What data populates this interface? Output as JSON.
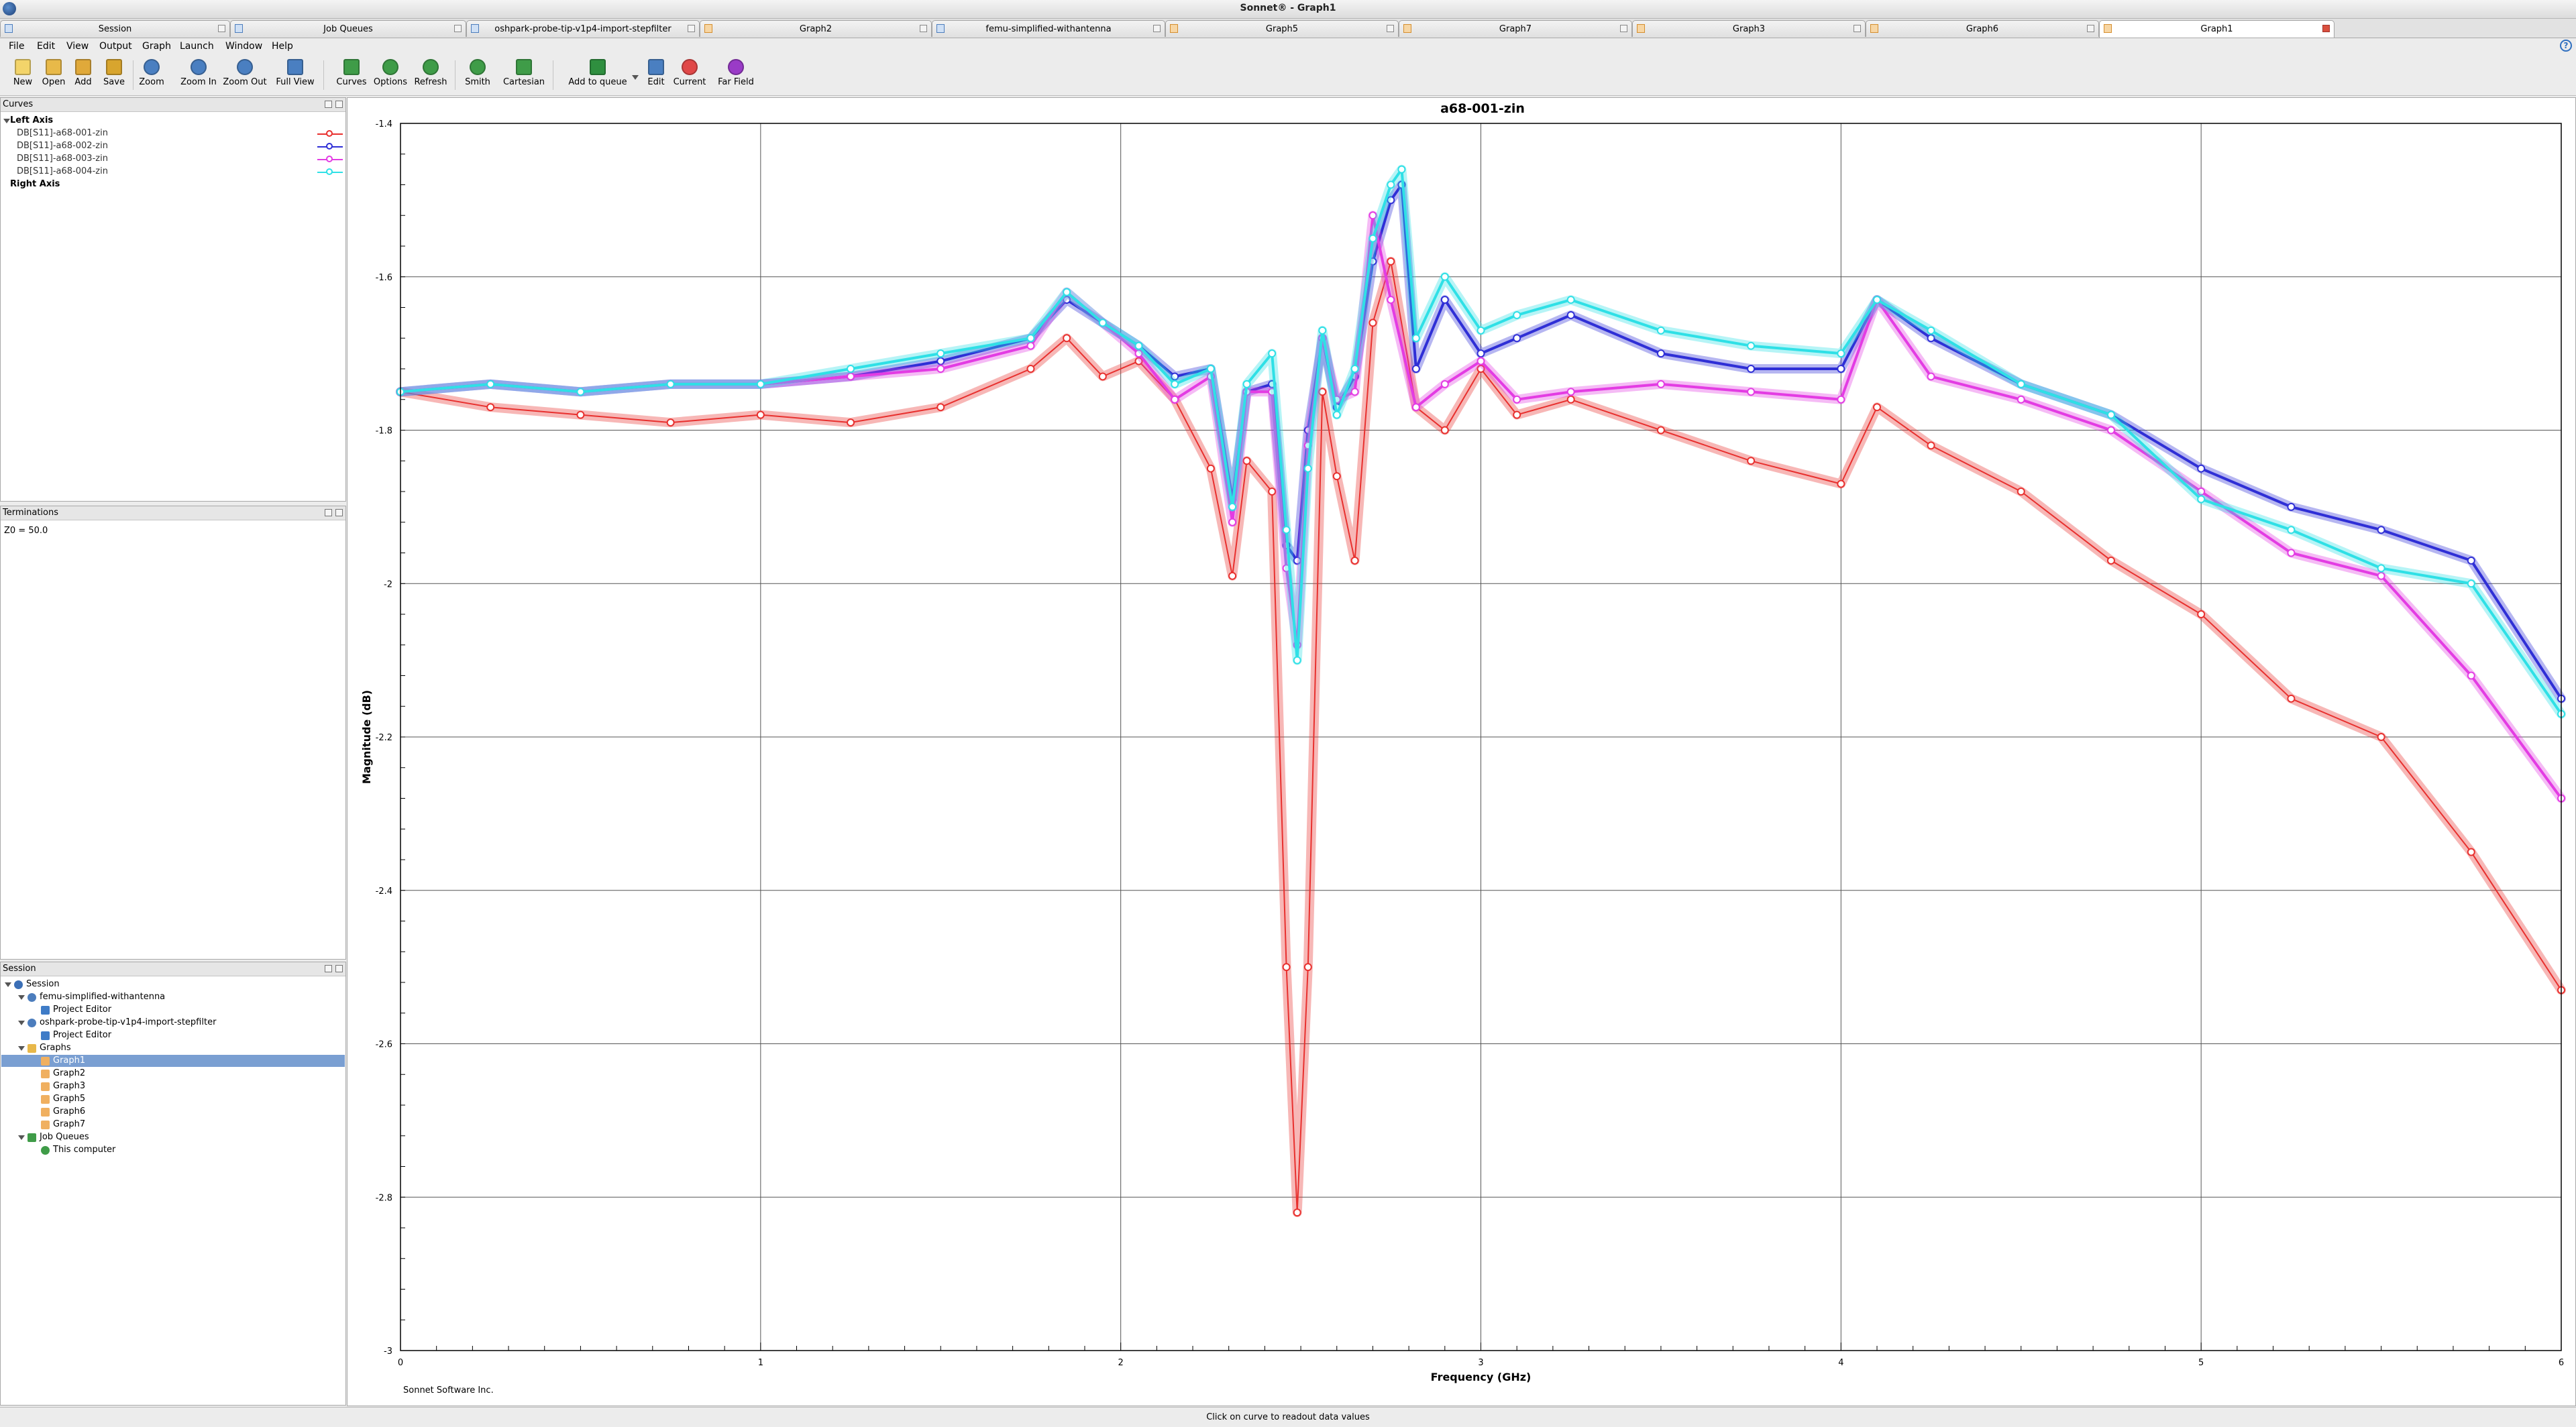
{
  "window": {
    "title": "Sonnet® - Graph1"
  },
  "tabs": [
    {
      "label": "Session",
      "icon": "session-icon"
    },
    {
      "label": "Job Queues",
      "icon": "job-queue-icon"
    },
    {
      "label": "oshpark-probe-tip-v1p4-import-stepfilter",
      "icon": "project-icon"
    },
    {
      "label": "Graph2",
      "icon": "graph-icon"
    },
    {
      "label": "femu-simplified-withantenna",
      "icon": "project-icon"
    },
    {
      "label": "Graph5",
      "icon": "graph-icon"
    },
    {
      "label": "Graph7",
      "icon": "graph-icon"
    },
    {
      "label": "Graph3",
      "icon": "graph-icon"
    },
    {
      "label": "Graph6",
      "icon": "graph-icon"
    },
    {
      "label": "Graph1",
      "icon": "graph-icon",
      "active": true
    }
  ],
  "menu": [
    "File",
    "Edit",
    "View",
    "Output",
    "Graph",
    "Launch",
    "Window",
    "Help"
  ],
  "help_icon": "?",
  "toolbar": [
    "New",
    "Open",
    "Add",
    "Save",
    "Zoom",
    "Zoom In",
    "Zoom Out",
    "Full View",
    "Curves",
    "Options",
    "Refresh",
    "Smith",
    "Cartesian",
    "Add to queue",
    "Edit",
    "Current",
    "Far Field"
  ],
  "curves_panel": {
    "title": "Curves",
    "left_axis": "Left Axis",
    "right_axis": "Right Axis",
    "items": [
      {
        "label": "DB[S11]-a68-001-zin",
        "color": "#e8302e"
      },
      {
        "label": "DB[S11]-a68-002-zin",
        "color": "#2f2fd6"
      },
      {
        "label": "DB[S11]-a68-003-zin",
        "color": "#e33ce3"
      },
      {
        "label": "DB[S11]-a68-004-zin",
        "color": "#2fe0e6"
      }
    ]
  },
  "terminations_panel": {
    "title": "Terminations",
    "text": "Z0 = 50.0"
  },
  "session_panel": {
    "title": "Session",
    "tree": [
      {
        "label": "Session",
        "level": 0,
        "expanded": true,
        "icon": "session-icon"
      },
      {
        "label": "femu-simplified-withantenna",
        "level": 1,
        "expanded": true,
        "icon": "project-icon"
      },
      {
        "label": "Project Editor",
        "level": 2,
        "icon": "editor-icon"
      },
      {
        "label": "oshpark-probe-tip-v1p4-import-stepfilter",
        "level": 1,
        "expanded": true,
        "icon": "project-icon"
      },
      {
        "label": "Project Editor",
        "level": 2,
        "icon": "editor-icon"
      },
      {
        "label": "Graphs",
        "level": 1,
        "expanded": true,
        "icon": "folder-icon"
      },
      {
        "label": "Graph1",
        "level": 2,
        "icon": "graph-icon",
        "selected": true
      },
      {
        "label": "Graph2",
        "level": 2,
        "icon": "graph-icon"
      },
      {
        "label": "Graph3",
        "level": 2,
        "icon": "graph-icon"
      },
      {
        "label": "Graph5",
        "level": 2,
        "icon": "graph-icon"
      },
      {
        "label": "Graph6",
        "level": 2,
        "icon": "graph-icon"
      },
      {
        "label": "Graph7",
        "level": 2,
        "icon": "graph-icon"
      },
      {
        "label": "Job Queues",
        "level": 1,
        "expanded": true,
        "icon": "job-queue-icon"
      },
      {
        "label": "This computer",
        "level": 2,
        "icon": "check-icon"
      }
    ]
  },
  "footer": {
    "credit": "Sonnet Software Inc.",
    "status": "Click on curve to readout data values"
  },
  "chart_data": {
    "type": "line",
    "title": "a68-001-zin",
    "xlabel": "Frequency (GHz)",
    "ylabel": "Magnitude (dB)",
    "xlim": [
      0,
      6
    ],
    "ylim": [
      -3,
      -1.4
    ],
    "xticks": [
      0,
      1,
      2,
      3,
      4,
      5,
      6
    ],
    "yticks": [
      -1.4,
      -1.6,
      -1.8,
      -2,
      -2.2,
      -2.4,
      -2.6,
      -2.8,
      -3
    ],
    "grid": true,
    "series": [
      {
        "name": "DB[S11]-a68-001-zin",
        "color": "#e8302e",
        "x": [
          0,
          0.25,
          0.5,
          0.75,
          1.0,
          1.25,
          1.5,
          1.75,
          1.85,
          1.95,
          2.05,
          2.15,
          2.25,
          2.31,
          2.35,
          2.42,
          2.46,
          2.49,
          2.52,
          2.56,
          2.6,
          2.65,
          2.7,
          2.75,
          2.82,
          2.9,
          3.0,
          3.1,
          3.25,
          3.5,
          3.75,
          4.0,
          4.1,
          4.25,
          4.5,
          4.75,
          5.0,
          5.25,
          5.5,
          5.75,
          6.0
        ],
        "y": [
          -1.75,
          -1.77,
          -1.78,
          -1.79,
          -1.78,
          -1.79,
          -1.77,
          -1.72,
          -1.68,
          -1.73,
          -1.71,
          -1.76,
          -1.85,
          -1.99,
          -1.84,
          -1.88,
          -2.5,
          -2.82,
          -2.5,
          -1.75,
          -1.86,
          -1.97,
          -1.66,
          -1.58,
          -1.77,
          -1.8,
          -1.72,
          -1.78,
          -1.76,
          -1.8,
          -1.84,
          -1.87,
          -1.77,
          -1.82,
          -1.88,
          -1.97,
          -2.04,
          -2.15,
          -2.2,
          -2.35,
          -2.53
        ]
      },
      {
        "name": "DB[S11]-a68-002-zin",
        "color": "#2f2fd6",
        "x": [
          0,
          0.25,
          0.5,
          0.75,
          1.0,
          1.25,
          1.5,
          1.75,
          1.85,
          1.95,
          2.05,
          2.15,
          2.25,
          2.31,
          2.35,
          2.42,
          2.46,
          2.49,
          2.52,
          2.56,
          2.6,
          2.65,
          2.7,
          2.75,
          2.78,
          2.82,
          2.9,
          3.0,
          3.1,
          3.25,
          3.5,
          3.75,
          4.0,
          4.1,
          4.25,
          4.5,
          4.75,
          5.0,
          5.25,
          5.5,
          5.75,
          6.0
        ],
        "y": [
          -1.75,
          -1.74,
          -1.75,
          -1.74,
          -1.74,
          -1.73,
          -1.71,
          -1.68,
          -1.63,
          -1.66,
          -1.69,
          -1.73,
          -1.72,
          -1.89,
          -1.75,
          -1.74,
          -1.95,
          -1.97,
          -1.8,
          -1.68,
          -1.77,
          -1.73,
          -1.58,
          -1.5,
          -1.48,
          -1.72,
          -1.63,
          -1.7,
          -1.68,
          -1.65,
          -1.7,
          -1.72,
          -1.72,
          -1.63,
          -1.68,
          -1.74,
          -1.78,
          -1.85,
          -1.9,
          -1.93,
          -1.97,
          -2.15
        ]
      },
      {
        "name": "DB[S11]-a68-003-zin",
        "color": "#e33ce3",
        "x": [
          0,
          0.25,
          0.5,
          0.75,
          1.0,
          1.25,
          1.5,
          1.75,
          1.85,
          1.95,
          2.05,
          2.15,
          2.25,
          2.31,
          2.35,
          2.42,
          2.46,
          2.49,
          2.52,
          2.56,
          2.6,
          2.65,
          2.7,
          2.75,
          2.82,
          2.9,
          3.0,
          3.1,
          3.25,
          3.5,
          3.75,
          4.0,
          4.1,
          4.25,
          4.5,
          4.75,
          5.0,
          5.25,
          5.5,
          5.75,
          6.0
        ],
        "y": [
          -1.75,
          -1.74,
          -1.75,
          -1.74,
          -1.74,
          -1.73,
          -1.72,
          -1.69,
          -1.62,
          -1.66,
          -1.7,
          -1.76,
          -1.73,
          -1.92,
          -1.75,
          -1.75,
          -1.98,
          -2.08,
          -1.82,
          -1.68,
          -1.76,
          -1.75,
          -1.52,
          -1.63,
          -1.77,
          -1.74,
          -1.71,
          -1.76,
          -1.75,
          -1.74,
          -1.75,
          -1.76,
          -1.63,
          -1.73,
          -1.76,
          -1.8,
          -1.88,
          -1.96,
          -1.99,
          -2.12,
          -2.28
        ]
      },
      {
        "name": "DB[S11]-a68-004-zin",
        "color": "#2fe0e6",
        "x": [
          0,
          0.25,
          0.5,
          0.75,
          1.0,
          1.25,
          1.5,
          1.75,
          1.85,
          1.95,
          2.05,
          2.15,
          2.25,
          2.31,
          2.35,
          2.42,
          2.46,
          2.49,
          2.52,
          2.56,
          2.6,
          2.65,
          2.7,
          2.75,
          2.78,
          2.82,
          2.9,
          3.0,
          3.1,
          3.25,
          3.5,
          3.75,
          4.0,
          4.1,
          4.25,
          4.5,
          4.75,
          5.0,
          5.25,
          5.5,
          5.75,
          6.0
        ],
        "y": [
          -1.75,
          -1.74,
          -1.75,
          -1.74,
          -1.74,
          -1.72,
          -1.7,
          -1.68,
          -1.62,
          -1.66,
          -1.69,
          -1.74,
          -1.72,
          -1.9,
          -1.74,
          -1.7,
          -1.93,
          -2.1,
          -1.85,
          -1.67,
          -1.78,
          -1.72,
          -1.55,
          -1.48,
          -1.46,
          -1.68,
          -1.6,
          -1.67,
          -1.65,
          -1.63,
          -1.67,
          -1.69,
          -1.7,
          -1.63,
          -1.67,
          -1.74,
          -1.78,
          -1.89,
          -1.93,
          -1.98,
          -2.0,
          -2.17
        ]
      }
    ]
  }
}
